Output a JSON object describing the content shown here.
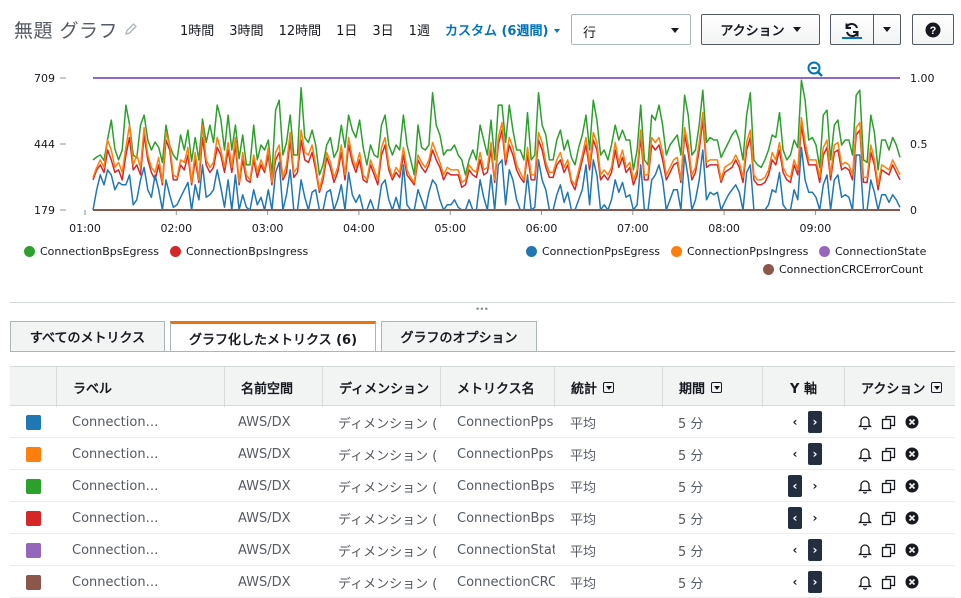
{
  "header": {
    "title": "無題 グラフ",
    "time_ranges": [
      "1時間",
      "3時間",
      "12時間",
      "1日",
      "3日",
      "1週"
    ],
    "custom_range": "カスタム (6週間)",
    "view_select": "行",
    "actions_label": "アクション",
    "help_label": "?"
  },
  "chart_data": {
    "type": "line",
    "x_ticks": [
      "01:00",
      "02:00",
      "03:00",
      "04:00",
      "05:00",
      "06:00",
      "07:00",
      "08:00",
      "09:00"
    ],
    "y_left_ticks": [
      "709",
      "444",
      "179"
    ],
    "y_right_ticks": [
      "1.00",
      "0.5",
      "0"
    ],
    "ylim_left": [
      179,
      709
    ],
    "ylim_right": [
      0,
      1
    ],
    "series": [
      {
        "name": "ConnectionBpsEgress",
        "color": "#2ca02c",
        "axis": "left",
        "values": [
          380,
          392,
          400,
          378,
          463,
          540,
          423,
          380,
          420,
          600,
          523,
          400,
          388,
          520,
          560,
          460,
          420,
          452,
          430,
          370,
          520,
          438,
          400,
          380,
          480,
          420,
          500,
          375,
          470,
          380,
          544,
          450,
          520,
          450,
          600,
          545,
          420,
          560,
          420,
          520,
          385,
          480,
          360,
          360,
          520,
          380,
          440,
          420,
          460,
          320,
          580,
          620,
          400,
          450,
          560,
          400,
          400,
          670,
          470,
          450,
          500,
          440,
          320,
          360,
          440,
          470,
          390,
          420,
          520,
          430,
          560,
          500,
          470,
          540,
          430,
          360,
          440,
          400,
          390,
          520,
          560,
          440,
          400,
          440,
          420,
          560,
          440,
          380,
          320,
          520,
          430,
          420,
          440,
          650,
          520,
          480,
          400,
          420,
          420,
          440,
          400,
          380,
          320,
          380,
          420,
          380,
          520,
          460,
          400,
          540,
          380,
          600,
          600,
          450,
          600,
          500,
          420,
          420,
          380,
          570,
          380,
          400,
          650,
          520,
          480,
          380,
          380,
          460,
          500,
          420,
          460,
          390,
          360,
          430,
          480,
          560,
          420,
          620,
          540,
          400,
          420,
          380,
          440,
          520,
          460,
          500,
          460,
          460,
          340,
          420,
          600,
          380,
          360,
          560,
          540,
          600,
          520,
          400,
          440,
          460,
          480,
          400,
          640,
          560,
          400,
          420,
          520,
          660,
          450,
          470,
          460,
          460,
          390,
          420,
          450,
          480,
          500,
          460,
          380,
          560,
          650,
          380,
          360,
          350,
          380,
          420,
          480,
          470,
          570,
          420,
          380,
          400,
          460,
          430,
          700,
          620,
          460,
          470,
          440,
          350,
          560,
          580,
          380,
          520,
          540,
          440,
          460,
          460,
          400,
          640,
          660,
          380,
          370,
          560,
          490,
          340,
          460,
          460,
          420,
          470,
          440,
          390
        ]
      },
      {
        "name": "ConnectionBpsIngress",
        "color": "#d62728",
        "axis": "left",
        "values": [
          300,
          340,
          360,
          330,
          420,
          380,
          330,
          340,
          300,
          400,
          470,
          340,
          360,
          320,
          480,
          380,
          330,
          300,
          360,
          280,
          460,
          420,
          300,
          300,
          360,
          340,
          400,
          280,
          380,
          290,
          470,
          360,
          330,
          350,
          430,
          400,
          330,
          420,
          330,
          440,
          280,
          380,
          300,
          290,
          380,
          310,
          360,
          330,
          400,
          280,
          380,
          410,
          300,
          330,
          460,
          310,
          330,
          460,
          380,
          370,
          410,
          340,
          250,
          300,
          390,
          350,
          290,
          330,
          410,
          300,
          440,
          370,
          330,
          380,
          300,
          290,
          360,
          320,
          280,
          400,
          440,
          340,
          300,
          330,
          310,
          400,
          320,
          300,
          280,
          380,
          350,
          330,
          360,
          420,
          380,
          350,
          300,
          330,
          320,
          320,
          320,
          270,
          280,
          340,
          320,
          310,
          380,
          320,
          330,
          420,
          290,
          440,
          500,
          360,
          440,
          400,
          340,
          310,
          290,
          400,
          300,
          300,
          460,
          420,
          350,
          310,
          310,
          360,
          380,
          330,
          360,
          290,
          260,
          320,
          380,
          440,
          340,
          460,
          420,
          300,
          320,
          300,
          330,
          420,
          350,
          390,
          330,
          350,
          280,
          320,
          470,
          300,
          300,
          440,
          420,
          440,
          380,
          300,
          330,
          360,
          370,
          290,
          480,
          410,
          300,
          330,
          420,
          540,
          350,
          360,
          360,
          360,
          290,
          330,
          340,
          350,
          380,
          350,
          290,
          420,
          470,
          300,
          280,
          280,
          290,
          320,
          380,
          360,
          420,
          330,
          300,
          290,
          360,
          320,
          520,
          420,
          360,
          360,
          360,
          290,
          400,
          430,
          300,
          410,
          420,
          340,
          350,
          340,
          300,
          480,
          500,
          290,
          290,
          410,
          360,
          260,
          340,
          330,
          320,
          360,
          330,
          300
        ]
      },
      {
        "name": "ConnectionPpsEgress",
        "color": "#1f77b4",
        "axis": "left",
        "values": [
          179,
          260,
          320,
          280,
          340,
          320,
          260,
          290,
          280,
          280,
          320,
          200,
          220,
          300,
          350,
          260,
          230,
          320,
          260,
          179,
          300,
          240,
          190,
          200,
          230,
          260,
          290,
          179,
          280,
          220,
          360,
          230,
          240,
          260,
          340,
          270,
          190,
          300,
          179,
          320,
          179,
          240,
          190,
          179,
          260,
          200,
          230,
          179,
          260,
          179,
          330,
          370,
          179,
          240,
          340,
          179,
          179,
          300,
          230,
          179,
          250,
          260,
          179,
          179,
          250,
          260,
          179,
          220,
          280,
          179,
          330,
          240,
          210,
          240,
          179,
          179,
          220,
          179,
          179,
          280,
          300,
          220,
          179,
          230,
          179,
          360,
          200,
          179,
          179,
          260,
          220,
          179,
          250,
          300,
          280,
          220,
          179,
          200,
          200,
          220,
          190,
          179,
          179,
          220,
          179,
          179,
          300,
          230,
          179,
          320,
          179,
          360,
          380,
          200,
          340,
          300,
          220,
          180,
          179,
          320,
          179,
          190,
          380,
          300,
          260,
          179,
          179,
          240,
          280,
          210,
          250,
          179,
          179,
          220,
          260,
          360,
          200,
          380,
          320,
          179,
          200,
          179,
          220,
          300,
          250,
          290,
          230,
          240,
          179,
          200,
          360,
          179,
          179,
          300,
          320,
          360,
          300,
          179,
          220,
          260,
          260,
          179,
          400,
          310,
          179,
          220,
          300,
          420,
          220,
          250,
          240,
          250,
          179,
          210,
          240,
          260,
          280,
          250,
          179,
          330,
          360,
          179,
          179,
          179,
          179,
          200,
          260,
          250,
          330,
          200,
          179,
          179,
          260,
          220,
          430,
          300,
          250,
          250,
          230,
          179,
          280,
          320,
          179,
          300,
          320,
          230,
          240,
          230,
          179,
          400,
          400,
          179,
          179,
          300,
          250,
          179,
          240,
          240,
          210,
          240,
          220,
          190
        ]
      },
      {
        "name": "ConnectionPpsIngress",
        "color": "#ff7f0e",
        "axis": "left",
        "values": [
          310,
          350,
          380,
          350,
          460,
          420,
          350,
          370,
          330,
          430,
          520,
          360,
          400,
          350,
          510,
          400,
          350,
          330,
          390,
          290,
          490,
          440,
          320,
          310,
          380,
          370,
          430,
          290,
          410,
          300,
          520,
          380,
          350,
          370,
          470,
          420,
          350,
          450,
          350,
          470,
          290,
          410,
          320,
          300,
          400,
          330,
          380,
          340,
          430,
          290,
          410,
          440,
          310,
          360,
          490,
          330,
          350,
          500,
          410,
          400,
          440,
          360,
          260,
          320,
          410,
          370,
          310,
          350,
          440,
          320,
          470,
          390,
          350,
          410,
          320,
          300,
          380,
          340,
          300,
          430,
          470,
          360,
          310,
          350,
          330,
          430,
          340,
          310,
          290,
          400,
          370,
          350,
          380,
          450,
          410,
          370,
          320,
          350,
          340,
          340,
          340,
          290,
          300,
          360,
          340,
          330,
          410,
          340,
          350,
          450,
          300,
          470,
          530,
          380,
          470,
          430,
          360,
          330,
          300,
          430,
          320,
          320,
          490,
          450,
          370,
          330,
          330,
          380,
          410,
          350,
          380,
          300,
          280,
          340,
          400,
          470,
          360,
          490,
          450,
          320,
          340,
          320,
          350,
          450,
          370,
          420,
          350,
          370,
          300,
          340,
          500,
          320,
          320,
          470,
          450,
          470,
          410,
          320,
          350,
          380,
          390,
          300,
          510,
          440,
          320,
          350,
          450,
          570,
          370,
          380,
          380,
          380,
          300,
          350,
          360,
          370,
          400,
          370,
          310,
          450,
          500,
          320,
          300,
          300,
          310,
          340,
          410,
          380,
          450,
          350,
          320,
          310,
          380,
          340,
          550,
          450,
          380,
          380,
          380,
          310,
          430,
          460,
          320,
          440,
          450,
          360,
          370,
          360,
          320,
          510,
          530,
          310,
          310,
          440,
          380,
          280,
          360,
          350,
          340,
          380,
          350,
          320
        ]
      },
      {
        "name": "ConnectionState",
        "color": "#9467bd",
        "axis": "right",
        "values": [
          1,
          1
        ]
      },
      {
        "name": "ConnectionCRCErrorCount",
        "color": "#8c564b",
        "axis": "right",
        "values": [
          0,
          0
        ]
      }
    ],
    "grid": false,
    "legend": "bottom"
  },
  "tabs": [
    {
      "label": "すべてのメトリクス"
    },
    {
      "label": "グラフ化したメトリクス (6)"
    },
    {
      "label": "グラフのオプション"
    }
  ],
  "table": {
    "columns": [
      "ラベル",
      "名前空間",
      "ディメンション",
      "メトリクス名",
      "統計",
      "期間",
      "Y 軸",
      "アクション"
    ],
    "rows": [
      {
        "color": "#1f77b4",
        "label": "Connection…",
        "namespace": "AWS/DX",
        "dimension": "ディメンション (",
        "metric": "ConnectionPps",
        "stat": "平均",
        "period": "5 分",
        "axis": "right"
      },
      {
        "color": "#ff7f0e",
        "label": "Connection…",
        "namespace": "AWS/DX",
        "dimension": "ディメンション (",
        "metric": "ConnectionPps",
        "stat": "平均",
        "period": "5 分",
        "axis": "right"
      },
      {
        "color": "#2ca02c",
        "label": "Connection…",
        "namespace": "AWS/DX",
        "dimension": "ディメンション (",
        "metric": "ConnectionBps",
        "stat": "平均",
        "period": "5 分",
        "axis": "left"
      },
      {
        "color": "#d62728",
        "label": "Connection…",
        "namespace": "AWS/DX",
        "dimension": "ディメンション (",
        "metric": "ConnectionBps",
        "stat": "平均",
        "period": "5 分",
        "axis": "left"
      },
      {
        "color": "#9467bd",
        "label": "Connection…",
        "namespace": "AWS/DX",
        "dimension": "ディメンション (",
        "metric": "ConnectionStat",
        "stat": "平均",
        "period": "5 分",
        "axis": "right"
      },
      {
        "color": "#8c564b",
        "label": "Connection…",
        "namespace": "AWS/DX",
        "dimension": "ディメンション (",
        "metric": "ConnectionCRC",
        "stat": "平均",
        "period": "5 分",
        "axis": "right"
      }
    ]
  },
  "icons": {
    "edit": "pencil-icon",
    "refresh": "refresh-icon",
    "zoom": "zoom-out-icon",
    "bell": "bell-icon",
    "copy": "copy-icon",
    "remove": "remove-icon"
  }
}
